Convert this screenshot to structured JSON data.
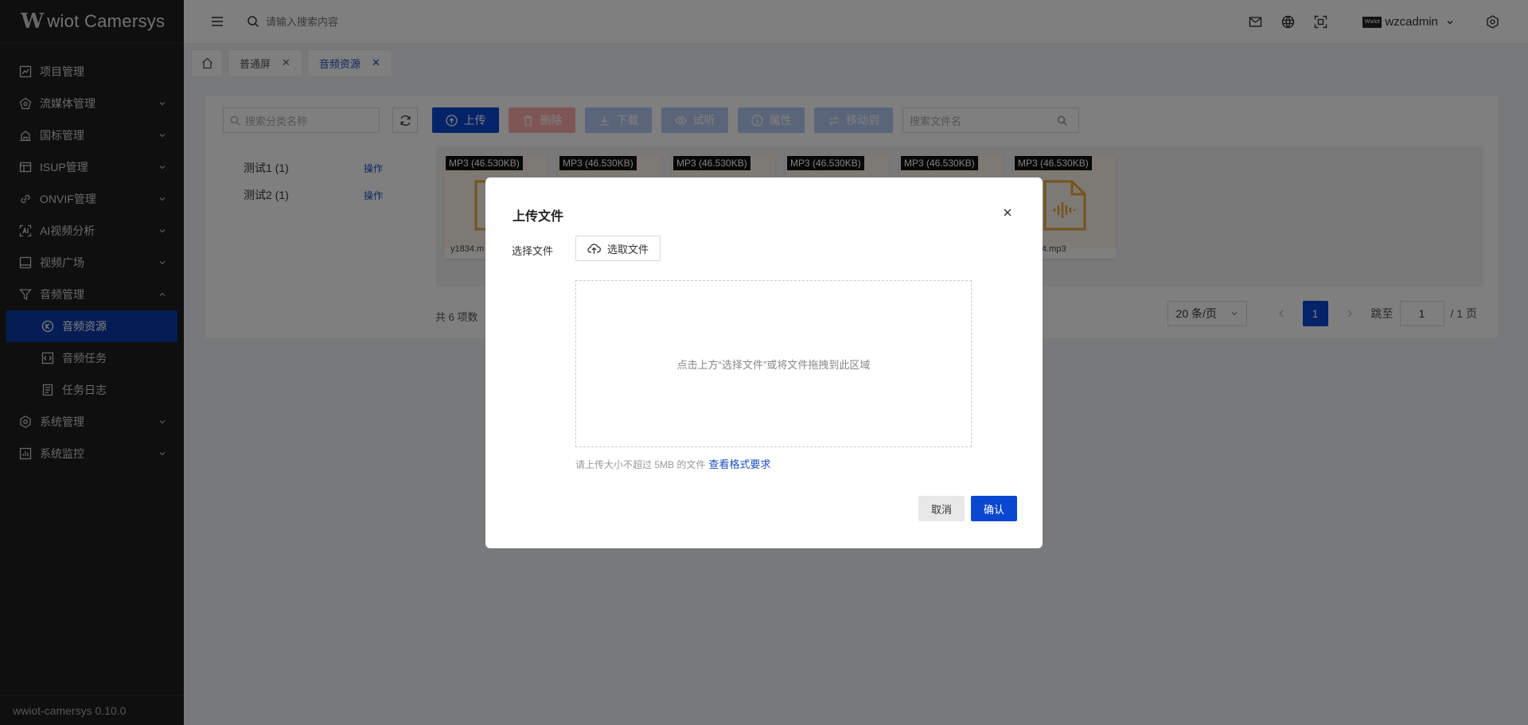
{
  "app": {
    "logo_letter": "W",
    "logo_text": "wiot Camersys",
    "version": "wwiot-camersys 0.10.0"
  },
  "sidebar": {
    "items": [
      {
        "label": "项目管理",
        "icon": "chart-icon",
        "expandable": false
      },
      {
        "label": "流媒体管理",
        "icon": "stream-icon",
        "expandable": true
      },
      {
        "label": "国标管理",
        "icon": "building-icon",
        "expandable": true
      },
      {
        "label": "ISUP管理",
        "icon": "grid-icon",
        "expandable": true
      },
      {
        "label": "ONVIF管理",
        "icon": "link-icon",
        "expandable": true
      },
      {
        "label": "AI视频分析",
        "icon": "ai-icon",
        "expandable": true
      },
      {
        "label": "视频广场",
        "icon": "video-icon",
        "expandable": true
      },
      {
        "label": "音频管理",
        "icon": "filter-icon",
        "expandable": true,
        "expanded": true
      }
    ],
    "sub_items": [
      {
        "label": "音频资源",
        "icon": "audio-icon",
        "active": true
      },
      {
        "label": "音频任务",
        "icon": "code-icon",
        "active": false
      },
      {
        "label": "任务日志",
        "icon": "log-icon",
        "active": false
      }
    ],
    "items_after": [
      {
        "label": "系统管理",
        "icon": "gear-icon",
        "expandable": true
      },
      {
        "label": "系统监控",
        "icon": "monitor-icon",
        "expandable": true
      }
    ]
  },
  "header": {
    "search_placeholder": "请输入搜索内容",
    "username": "wzcadmin",
    "avatar_text": "Wwiot"
  },
  "tabs": [
    {
      "label": "普通屏",
      "active": false
    },
    {
      "label": "音频资源",
      "active": true
    }
  ],
  "toolbar": {
    "category_search_placeholder": "搜索分类名称",
    "upload": "上传",
    "delete": "删除",
    "download": "下载",
    "preview": "试听",
    "properties": "属性",
    "move": "移动到",
    "file_search_placeholder": "搜索文件名"
  },
  "categories": [
    {
      "name": "测试1 (1)",
      "action": "操作"
    },
    {
      "name": "测试2 (1)",
      "action": "操作"
    }
  ],
  "files": [
    {
      "badge": "MP3 (46.530KB)",
      "name": "y1834.m"
    },
    {
      "badge": "MP3 (46.530KB)",
      "name": ""
    },
    {
      "badge": "MP3 (46.530KB)",
      "name": ""
    },
    {
      "badge": "MP3 (46.530KB)",
      "name": ""
    },
    {
      "badge": "MP3 (46.530KB)",
      "name": ""
    },
    {
      "badge": "MP3 (46.530KB)",
      "name": "4.mp3"
    }
  ],
  "pagination": {
    "total_text": "共 6 项数",
    "page_size": "20 条/页",
    "current_page": "1",
    "jump_label": "跳至",
    "jump_value": "1",
    "total_pages": "/ 1 页"
  },
  "modal": {
    "title": "上传文件",
    "choose_label": "选择文件",
    "choose_button": "选取文件",
    "drop_text": "点击上方“选择文件”或将文件拖拽到此区域",
    "hint": "请上传大小不超过 5MB 的文件",
    "hint_link": "查看格式要求",
    "cancel": "取消",
    "confirm": "确认"
  },
  "colors": {
    "primary": "#0a47d1",
    "sidebar_bg": "#1f1f1f",
    "sidebar_active": "#0a3ba8",
    "audio_icon": "#e8a83a"
  }
}
